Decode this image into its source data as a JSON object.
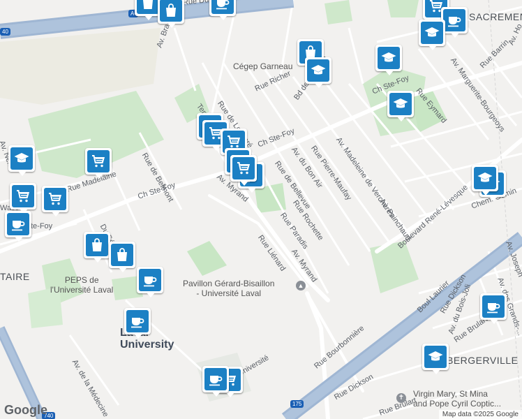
{
  "map": {
    "brand": "Google",
    "attribution": "Map data ©2025 Google",
    "highways": [
      {
        "label": "A-",
        "route": "40"
      },
      {
        "label": "",
        "route": "740"
      },
      {
        "label": "",
        "route": "175"
      }
    ]
  },
  "streets": [
    {
      "text": "Av. Branly"
    },
    {
      "text": "Terr. Louis"
    },
    {
      "text": "Rue de Longpré"
    },
    {
      "text": "Rue Richer"
    },
    {
      "text": "Bd de l'Entente"
    },
    {
      "text": "Ch Ste-Foy"
    },
    {
      "text": "Ch Ste-Foy"
    },
    {
      "text": "Ch Ste-Foy"
    },
    {
      "text": "Rue de Belmont"
    },
    {
      "text": "Rue de Bellevue"
    },
    {
      "text": "Av. du Bon Air"
    },
    {
      "text": "Rue Pierre-Maufay"
    },
    {
      "text": "Av. Madeleine de Verchères"
    },
    {
      "text": "Av. Painchaud"
    },
    {
      "text": "Rue Eymard"
    },
    {
      "text": "Av. Marguerite-Bourgeoys"
    },
    {
      "text": "Rue Barrin"
    },
    {
      "text": "Boulevard René-Lévesque"
    },
    {
      "text": "Chem. Gomin"
    },
    {
      "text": "Rue Rochette"
    },
    {
      "text": "Rue Paradis"
    },
    {
      "text": "Av. Myrand"
    },
    {
      "text": "Av. Myrand"
    },
    {
      "text": "Rue Liénard"
    },
    {
      "text": "Boul Laurier"
    },
    {
      "text": "Rue Bourbonnière"
    },
    {
      "text": "Rue Dickson"
    },
    {
      "text": "Rue Dickson"
    },
    {
      "text": "Rue Brulart"
    },
    {
      "text": "Rue Brulart"
    },
    {
      "text": "Av. du Bois-Joli"
    },
    {
      "text": "Av. des Grands-..."
    },
    {
      "text": "Av. Joseph"
    },
    {
      "text": "Av. de la Médecine"
    },
    {
      "text": "Du Séminaire"
    },
    {
      "text": "Rue Madelaine"
    },
    {
      "text": "Av. Néri"
    },
    {
      "text": "Université"
    },
    {
      "text": "Av. Ho"
    },
    {
      "text": "Rue Duquet"
    }
  ],
  "places": [
    {
      "text": "Cégep Garneau"
    },
    {
      "text": "PEPS de\nl'Université Laval"
    },
    {
      "text": "Pavillon Gérard-Bisaillon\n- Université Laval"
    },
    {
      "text": "Virgin Mary, St Mina\nand Pope Cyril Coptic..."
    },
    {
      "text": "Laval\nUniversity"
    },
    {
      "text": "SACREMENT"
    },
    {
      "text": "BERGERVILLE"
    },
    {
      "text": "TAIRE"
    },
    {
      "text": "Wass"
    },
    {
      "text": "te-Foy"
    }
  ],
  "markers": [
    {
      "type": "shopping-bag"
    },
    {
      "type": "shopping-bag"
    },
    {
      "type": "cafe"
    },
    {
      "type": "shopping-bag"
    },
    {
      "type": "school"
    },
    {
      "type": "cart"
    },
    {
      "type": "cafe"
    },
    {
      "type": "school"
    },
    {
      "type": "school"
    },
    {
      "type": "school"
    },
    {
      "type": "cafe"
    },
    {
      "type": "cart"
    },
    {
      "type": "cart"
    },
    {
      "type": "restaurant"
    },
    {
      "type": "restaurant"
    },
    {
      "type": "school"
    },
    {
      "type": "cart"
    },
    {
      "type": "cart"
    },
    {
      "type": "cart"
    },
    {
      "type": "cafe"
    },
    {
      "type": "shopping-bag"
    },
    {
      "type": "shopping-bag"
    },
    {
      "type": "cafe"
    },
    {
      "type": "cafe"
    },
    {
      "type": "cart"
    },
    {
      "type": "school"
    },
    {
      "type": "school"
    },
    {
      "type": "cafe"
    },
    {
      "type": "school"
    },
    {
      "type": "cafe"
    },
    {
      "type": "cart"
    }
  ],
  "colors": {
    "background": "#f2f1ef",
    "park": "#c8e6c4",
    "highway": "#a8bfd8",
    "marker": "#1c80c4"
  }
}
